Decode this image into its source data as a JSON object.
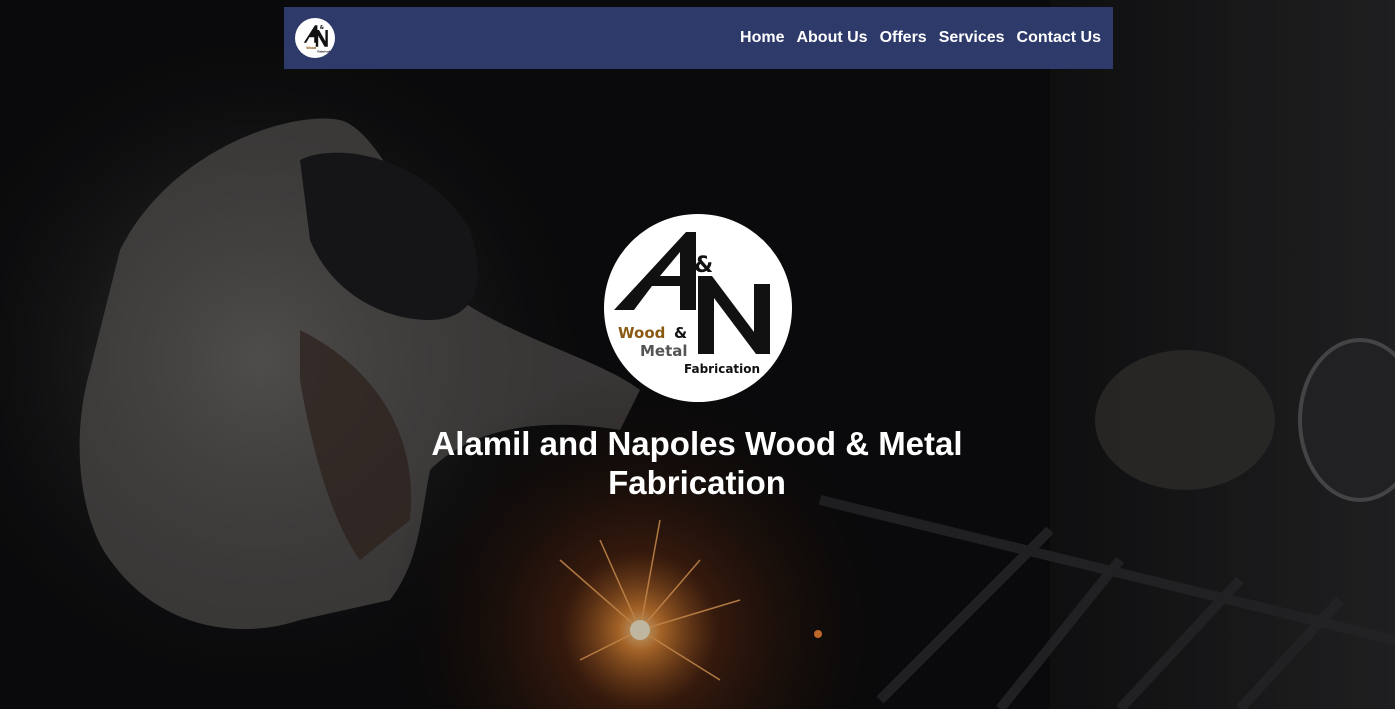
{
  "nav": {
    "links": [
      {
        "label": "Home"
      },
      {
        "label": "About Us"
      },
      {
        "label": "Offers"
      },
      {
        "label": "Services"
      },
      {
        "label": "Contact Us"
      }
    ]
  },
  "hero": {
    "title": "Alamil and Napoles Wood & Metal Fabrication",
    "background_image": "welder-sparks-dark-workshop"
  },
  "logo": {
    "mark_letter_a": "A",
    "mark_ampersand": "&",
    "mark_letter_n": "N",
    "wood": "Wood",
    "amp": "&",
    "metal": "Metal",
    "fabrication": "Fabrication"
  },
  "colors": {
    "navbar": "#2e3a6a",
    "wood_text": "#8a5a14",
    "logo_black": "#111111",
    "hero_text": "#ffffff"
  }
}
